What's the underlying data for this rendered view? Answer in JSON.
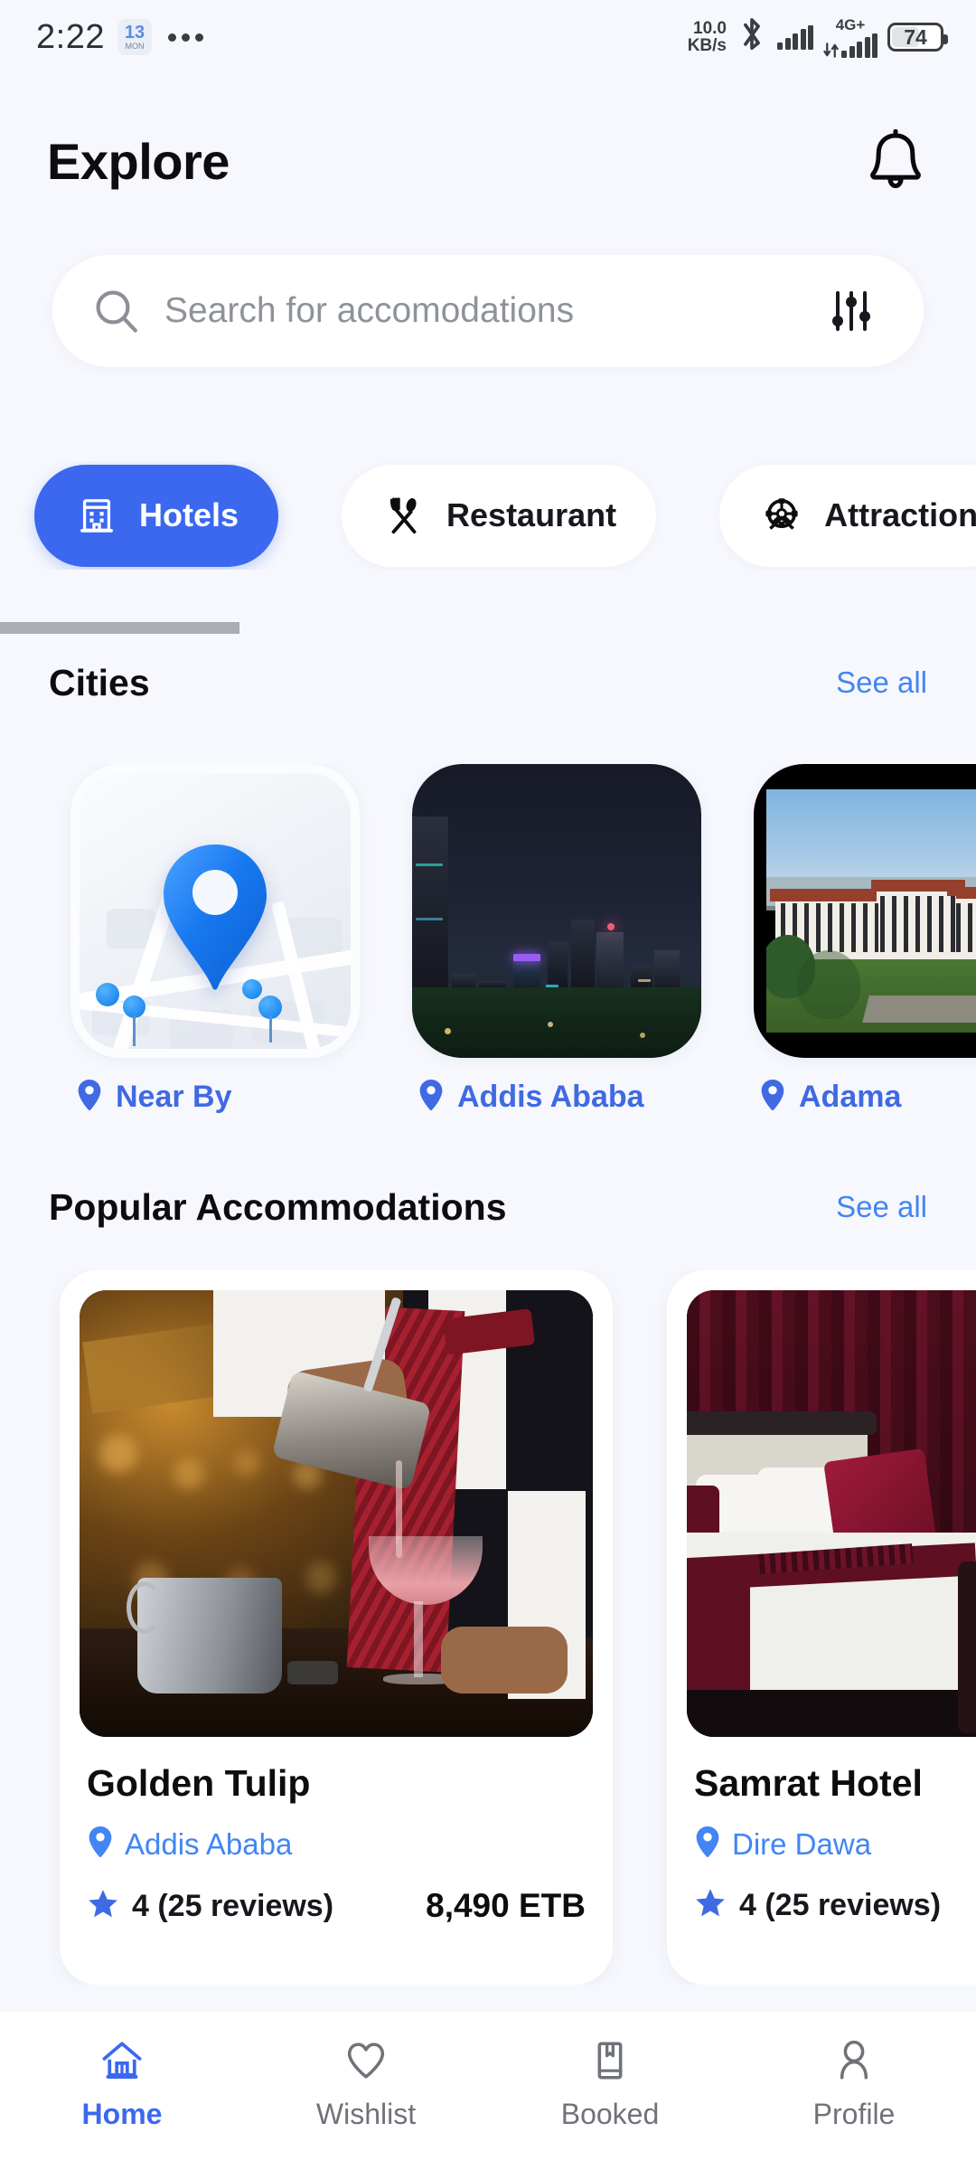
{
  "status_bar": {
    "time": "2:22",
    "calendar_day": "13",
    "calendar_weekday": "MON",
    "overflow_icon": "more-horizontal-icon",
    "net_speed_value": "10.0",
    "net_speed_unit": "KB/s",
    "bluetooth_icon": "bluetooth-icon",
    "network_type": "4G+",
    "battery_percent": "74"
  },
  "header": {
    "title": "Explore",
    "notification_icon": "bell-icon"
  },
  "search": {
    "placeholder": "Search for accomodations",
    "value": "",
    "search_icon": "search-icon",
    "filter_icon": "filter-sliders-icon"
  },
  "categories": {
    "items": [
      {
        "label": "Hotels",
        "icon": "hotel-building-icon",
        "active": true
      },
      {
        "label": "Restaurant",
        "icon": "fork-spoon-icon",
        "active": false
      },
      {
        "label": "Attraction",
        "icon": "ferris-wheel-icon",
        "active": false
      }
    ]
  },
  "cities_section": {
    "title": "Cities",
    "see_all": "See all",
    "items": [
      {
        "name": "Near By",
        "pin_icon": "map-pin-icon",
        "thumb": "map-with-pin-illustration"
      },
      {
        "name": "Addis Ababa",
        "pin_icon": "map-pin-icon",
        "thumb": "night-city-skyline-photo"
      },
      {
        "name": "Adama",
        "pin_icon": "map-pin-icon",
        "thumb": "daytime-resort-aerial-photo"
      }
    ]
  },
  "popular_section": {
    "title": "Popular Accommodations",
    "see_all": "See all",
    "items": [
      {
        "name": "Golden Tulip",
        "city": "Addis Ababa",
        "pin_icon": "map-pin-icon",
        "star_icon": "star-icon",
        "rating": "4 (25 reviews)",
        "price": "8,490 ETB",
        "thumb": "bartender-pouring-cocktail-photo"
      },
      {
        "name": "Samrat Hotel",
        "city": "Dire Dawa",
        "pin_icon": "map-pin-icon",
        "star_icon": "star-icon",
        "rating": "4 (25 reviews)",
        "price": "",
        "thumb": "hotel-bedroom-photo"
      }
    ]
  },
  "bottom_nav": {
    "items": [
      {
        "label": "Home",
        "icon": "home-icon",
        "active": true
      },
      {
        "label": "Wishlist",
        "icon": "heart-icon",
        "active": false
      },
      {
        "label": "Booked",
        "icon": "bookmark-book-icon",
        "active": false
      },
      {
        "label": "Profile",
        "icon": "person-icon",
        "active": false
      }
    ]
  },
  "colors": {
    "accent": "#3b68ef",
    "link": "#4285f4",
    "background": "#f7f8fd",
    "surface": "#ffffff"
  }
}
